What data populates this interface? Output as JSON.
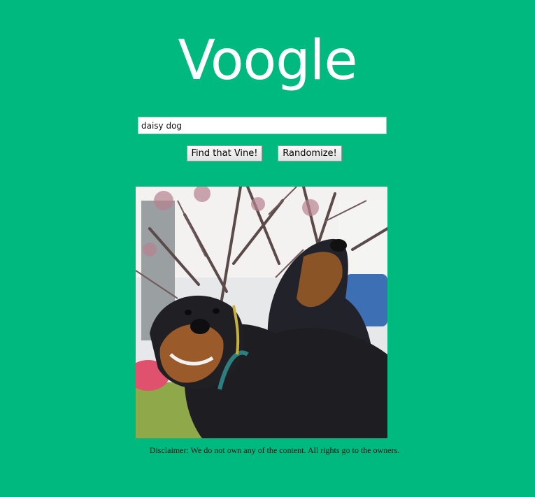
{
  "header": {
    "logo_text": "Voogle"
  },
  "search": {
    "value": "daisy dog",
    "placeholder": ""
  },
  "buttons": {
    "find_label": "Find that Vine!",
    "randomize_label": "Randomize!"
  },
  "result": {
    "media": "video-thumbnail-two-rottweilers"
  },
  "footer": {
    "disclaimer": "Disclaimer: We do not own any of the content. All rights go to the owners."
  },
  "colors": {
    "background": "#00b97e",
    "logo": "#ffffff"
  }
}
